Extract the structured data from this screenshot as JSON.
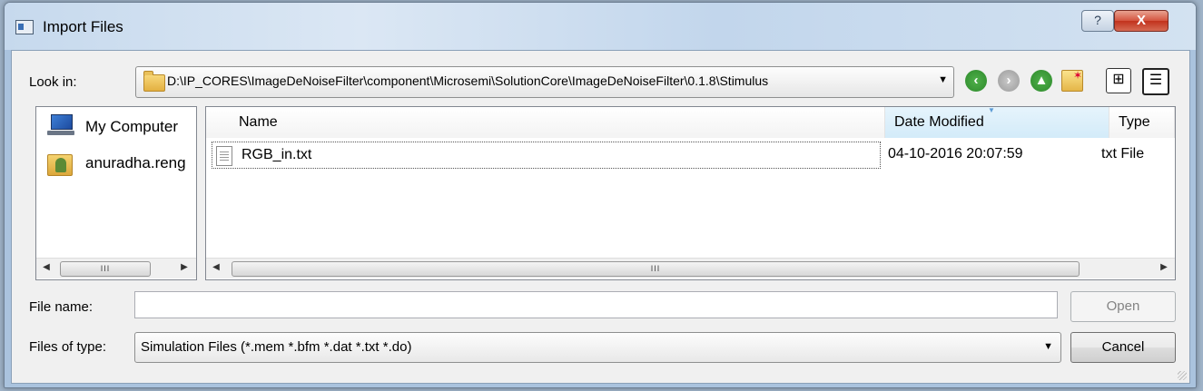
{
  "window": {
    "title": "Import Files",
    "help_glyph": "?",
    "close_glyph": "X"
  },
  "look_in": {
    "label": "Look in:",
    "path": "D:\\IP_CORES\\ImageDeNoiseFilter\\component\\Microsemi\\SolutionCore\\ImageDeNoiseFilter\\0.1.8\\Stimulus"
  },
  "nav": {
    "back_glyph": "‹",
    "forward_glyph": "›",
    "up_glyph": "▲",
    "list_view_glyph": "⊞",
    "detail_view_glyph": "☰"
  },
  "sidebar": {
    "items": [
      {
        "label": "My Computer",
        "icon": "computer-icon"
      },
      {
        "label": "anuradha.reng",
        "icon": "user-folder-icon"
      }
    ]
  },
  "files": {
    "columns": [
      "Name",
      "Date Modified",
      "Type"
    ],
    "rows": [
      {
        "name": "RGB_in.txt",
        "date": "04-10-2016 20:07:59",
        "type": "txt File"
      }
    ]
  },
  "scroll": {
    "grip": "III"
  },
  "file_name": {
    "label": "File name:",
    "value": ""
  },
  "file_type": {
    "label": "Files of type:",
    "value": "Simulation Files (*.mem *.bfm *.dat *.txt *.do)"
  },
  "buttons": {
    "open": "Open",
    "cancel": "Cancel"
  }
}
